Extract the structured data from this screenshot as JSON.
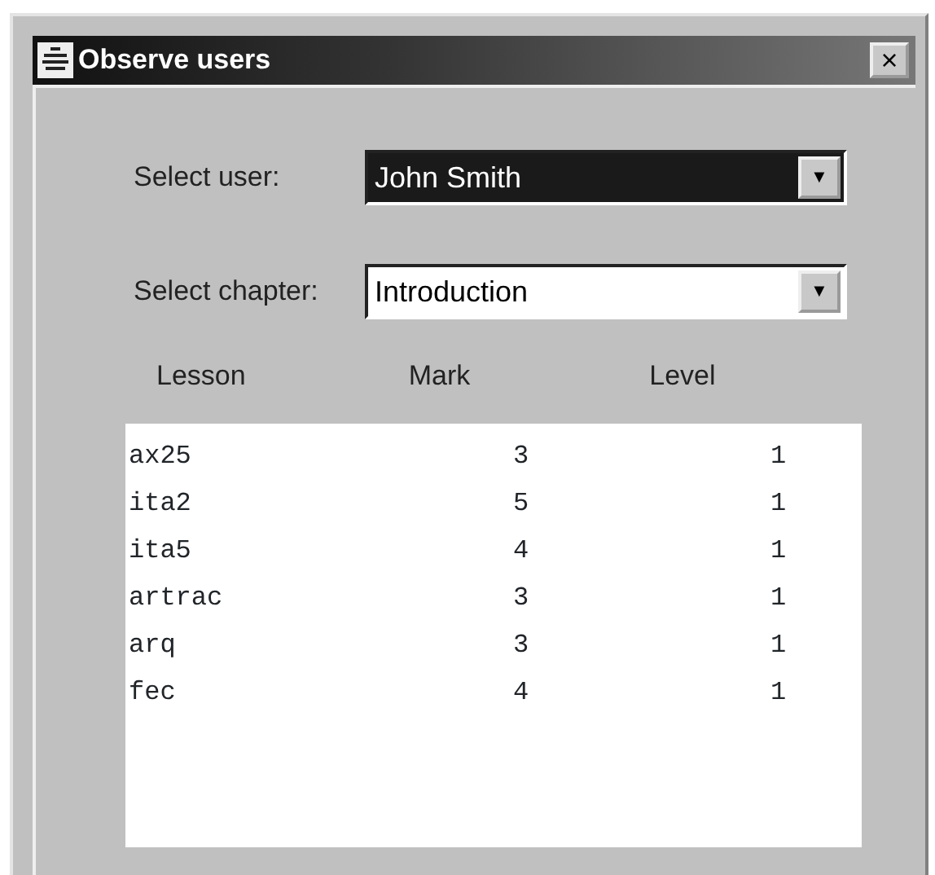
{
  "window": {
    "title": "Observe users",
    "close": "×"
  },
  "fields": [
    {
      "label": "Select user:",
      "value": "John Smith",
      "focused": true,
      "arrow": "▼"
    },
    {
      "label": "Select chapter:",
      "value": "Introduction",
      "focused": false,
      "arrow": "▼"
    }
  ],
  "table": {
    "columns": [
      "Lesson",
      "Mark",
      "Level"
    ],
    "rows": [
      [
        "ax25",
        "3",
        "1"
      ],
      [
        "ita2",
        "5",
        "1"
      ],
      [
        "ita5",
        "4",
        "1"
      ],
      [
        "artrac",
        "3",
        "1"
      ],
      [
        "arq",
        "3",
        "1"
      ],
      [
        "fec",
        "4",
        "1"
      ]
    ]
  }
}
